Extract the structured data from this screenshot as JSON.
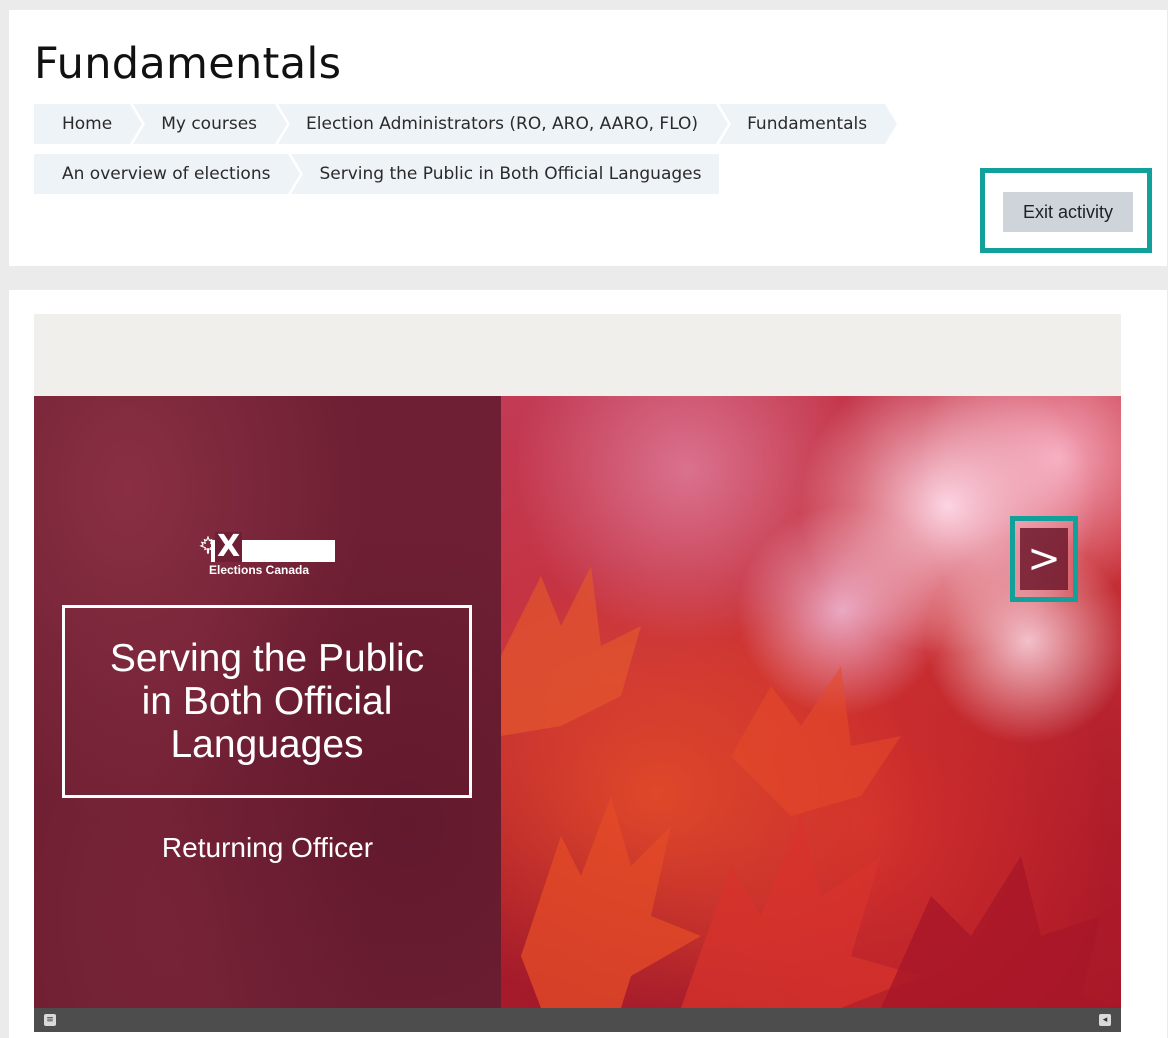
{
  "header": {
    "title": "Fundamentals",
    "breadcrumb_row1": [
      "Home",
      "My courses",
      "Election Administrators (RO, ARO, AARO, FLO)",
      "Fundamentals"
    ],
    "breadcrumb_row2": [
      "An overview of elections",
      "Serving the Public in Both Official Languages"
    ],
    "exit_button_label": "Exit activity"
  },
  "slide": {
    "logo_text": "Elections Canada",
    "title": "Serving the Public\nin Both Official\nLanguages",
    "subtitle": "Returning Officer",
    "next_glyph": ">"
  },
  "colors": {
    "highlight": "#12a19a",
    "slide_panel": "#6e1f33",
    "exit_button_bg": "#ced4da",
    "breadcrumb_bg": "#eef3f8"
  },
  "icons": {
    "next": "chevron-right-icon",
    "menu": "menu-icon",
    "volume": "volume-icon"
  }
}
